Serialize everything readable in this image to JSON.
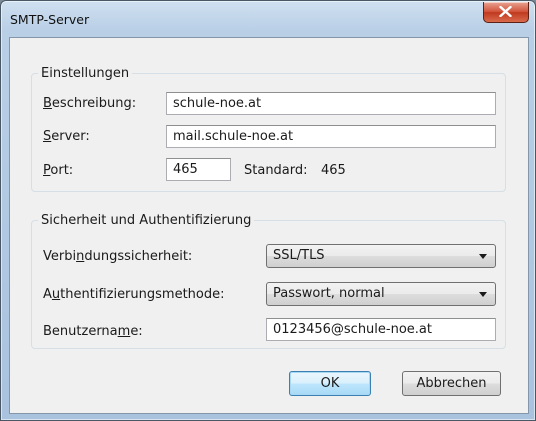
{
  "window": {
    "title": "SMTP-Server",
    "close_icon": "close-icon"
  },
  "settings": {
    "legend": "Einstellungen",
    "description": {
      "label_mnemonic": "B",
      "label_rest": "eschreibung:",
      "value": "schule-noe.at"
    },
    "server": {
      "label_mnemonic": "S",
      "label_rest": "erver:",
      "value": "mail.schule-noe.at"
    },
    "port": {
      "label_mnemonic": "P",
      "label_rest": "ort:",
      "value": "465",
      "default_label": "Standard:",
      "default_value": "465"
    }
  },
  "security": {
    "legend": "Sicherheit und Authentifizierung",
    "connection": {
      "label_pre": "Verbi",
      "label_mnemonic": "n",
      "label_post": "dungssicherheit:",
      "value": "SSL/TLS"
    },
    "auth_method": {
      "label_pre": "A",
      "label_mnemonic": "u",
      "label_post": "thentifizierungsmethode:",
      "value": "Passwort, normal"
    },
    "username": {
      "label_pre": "Benutzerna",
      "label_mnemonic": "m",
      "label_post": "e:",
      "value": "0123456@schule-noe.at"
    }
  },
  "buttons": {
    "ok": "OK",
    "cancel": "Abbrechen"
  }
}
